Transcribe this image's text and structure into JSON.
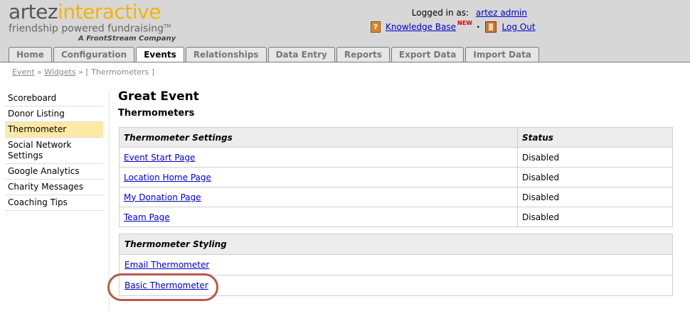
{
  "logo": {
    "brand_part1": "artez",
    "brand_part2": "interactive",
    "tagline": "friendship powered fundraising",
    "tagline_mark": "TM",
    "subtitle": "A FrontStream Company"
  },
  "user": {
    "logged_in_label": "Logged in as:",
    "username": "artez admin",
    "knowledge_base": "Knowledge Base",
    "new_badge": "NEW",
    "separator": "·",
    "logout": "Log Out"
  },
  "tabs": [
    {
      "label": "Home"
    },
    {
      "label": "Configuration"
    },
    {
      "label": "Events"
    },
    {
      "label": "Relationships"
    },
    {
      "label": "Data Entry"
    },
    {
      "label": "Reports"
    },
    {
      "label": "Export Data"
    },
    {
      "label": "Import Data"
    }
  ],
  "breadcrumb": {
    "event": "Event",
    "sep1": "»",
    "widgets": "Widgets",
    "sep2": "»",
    "current": "[ Thermometers ]"
  },
  "sidebar": {
    "items": [
      {
        "label": "Scoreboard"
      },
      {
        "label": "Donor Listing"
      },
      {
        "label": "Thermometer"
      },
      {
        "label": "Social Network Settings"
      },
      {
        "label": "Google Analytics"
      },
      {
        "label": "Charity Messages"
      },
      {
        "label": "Coaching Tips"
      }
    ]
  },
  "main": {
    "event_title": "Great Event",
    "section_title": "Thermometers",
    "settings_table": {
      "headers": [
        "Thermometer Settings",
        "Status"
      ],
      "rows": [
        {
          "name": "Event Start Page",
          "status": "Disabled"
        },
        {
          "name": "Location Home Page",
          "status": "Disabled"
        },
        {
          "name": "My Donation Page",
          "status": "Disabled"
        },
        {
          "name": "Team Page",
          "status": "Disabled"
        }
      ]
    },
    "styling_table": {
      "header": "Thermometer Styling",
      "rows": [
        {
          "name": "Email Thermometer"
        },
        {
          "name": "Basic Thermometer"
        }
      ]
    }
  },
  "colors": {
    "header_bg": "#d7d7d7",
    "brand_yellow": "#f3b400",
    "active_sidebar": "#fee9a5",
    "highlight_ring": "#b85a48",
    "link": "#0000cc"
  }
}
